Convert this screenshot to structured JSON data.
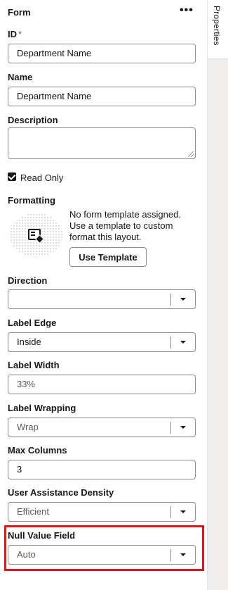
{
  "header": {
    "title": "Form",
    "more_label": "•••"
  },
  "rail": {
    "tab_label": "Properties"
  },
  "id_field": {
    "label": "ID",
    "required_mark": "*",
    "value": "Department Name"
  },
  "name_field": {
    "label": "Name",
    "value": "Department Name"
  },
  "description_field": {
    "label": "Description",
    "value": ""
  },
  "read_only": {
    "label": "Read Only",
    "checked": true
  },
  "formatting": {
    "label": "Formatting",
    "message": "No form template assigned. Use a template to custom format this layout.",
    "button_label": "Use Template"
  },
  "direction": {
    "label": "Direction",
    "value": ""
  },
  "label_edge": {
    "label": "Label Edge",
    "value": "Inside"
  },
  "label_width": {
    "label": "Label Width",
    "placeholder": "33%"
  },
  "label_wrapping": {
    "label": "Label Wrapping",
    "value": "Wrap"
  },
  "max_columns": {
    "label": "Max Columns",
    "value": "3"
  },
  "user_assistance_density": {
    "label": "User Assistance Density",
    "value": "Efficient"
  },
  "null_value_field": {
    "label": "Null Value Field",
    "value": "Auto"
  },
  "colors": {
    "highlight": "#e2151b",
    "required": "#1f6fb5"
  }
}
